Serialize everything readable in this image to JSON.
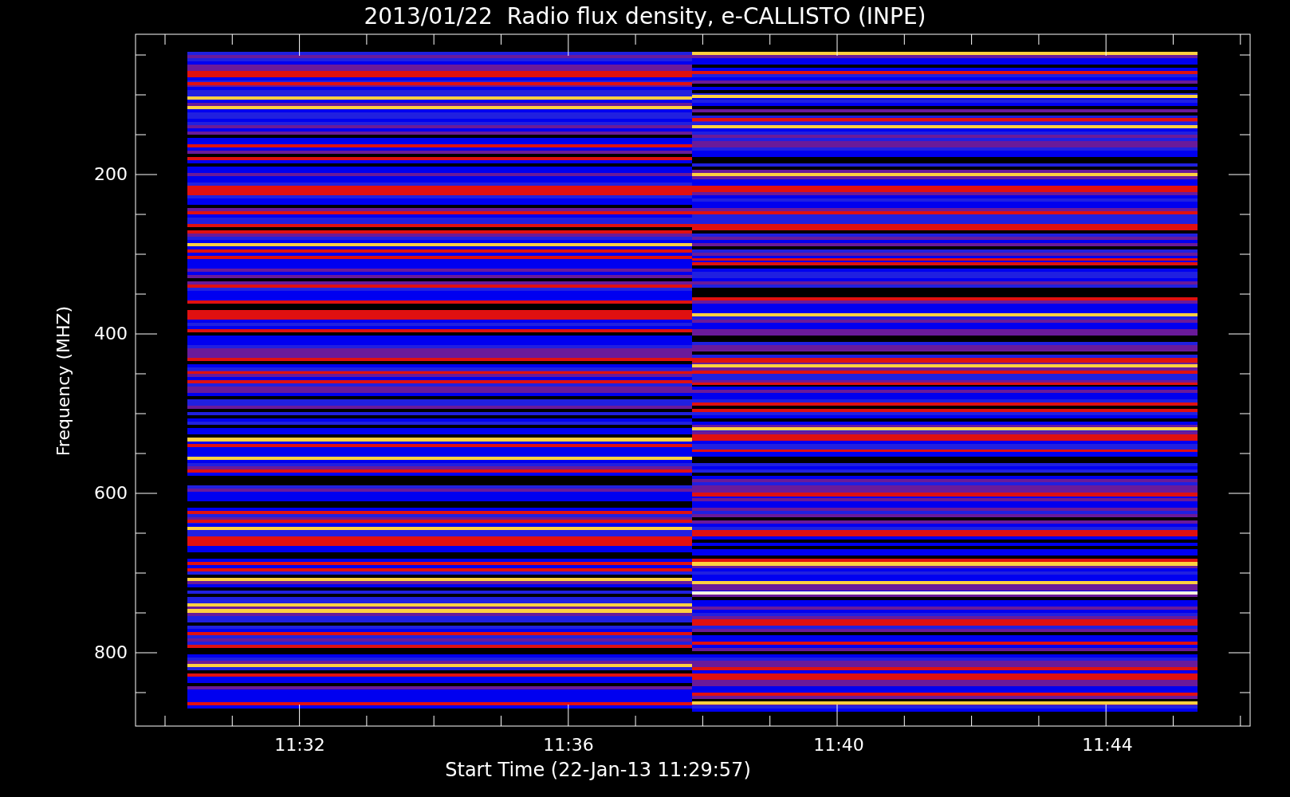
{
  "title": "2013/01/22  Radio flux density, e-CALLISTO (INPE)",
  "y_axis": {
    "label": "Frequency (MHZ)",
    "ticks": [
      "200",
      "400",
      "600",
      "800"
    ]
  },
  "x_axis": {
    "label": "Start Time (22-Jan-13 11:29:57)",
    "ticks": [
      "11:32",
      "11:36",
      "11:40",
      "11:44"
    ]
  }
}
